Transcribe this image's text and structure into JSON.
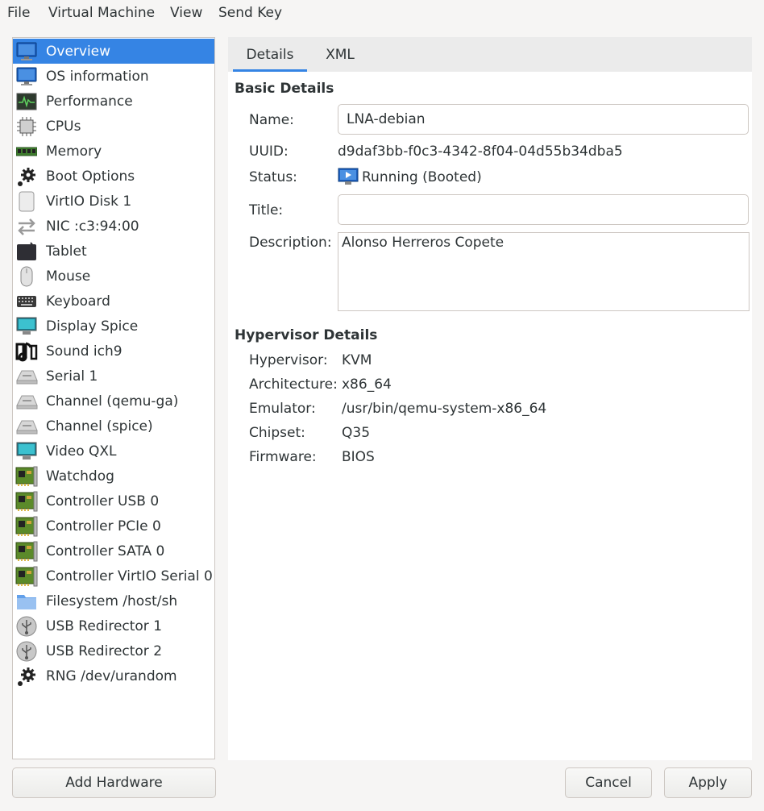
{
  "menu": {
    "file": "File",
    "vm": "Virtual Machine",
    "view": "View",
    "sendkey": "Send Key"
  },
  "sidebar": {
    "items": [
      {
        "label": "Overview",
        "icon": "monitor-icon"
      },
      {
        "label": "OS information",
        "icon": "monitor-icon"
      },
      {
        "label": "Performance",
        "icon": "performance-graph-icon"
      },
      {
        "label": "CPUs",
        "icon": "cpu-chip-icon"
      },
      {
        "label": "Memory",
        "icon": "memory-module-icon"
      },
      {
        "label": "Boot Options",
        "icon": "gear-icon"
      },
      {
        "label": "VirtIO Disk 1",
        "icon": "disk-icon"
      },
      {
        "label": "NIC :c3:94:00",
        "icon": "network-arrows-icon"
      },
      {
        "label": "Tablet",
        "icon": "tablet-icon"
      },
      {
        "label": "Mouse",
        "icon": "mouse-icon"
      },
      {
        "label": "Keyboard",
        "icon": "keyboard-icon"
      },
      {
        "label": "Display Spice",
        "icon": "display-icon"
      },
      {
        "label": "Sound ich9",
        "icon": "sound-icon"
      },
      {
        "label": "Serial 1",
        "icon": "serial-port-icon"
      },
      {
        "label": "Channel (qemu-ga)",
        "icon": "serial-port-icon"
      },
      {
        "label": "Channel (spice)",
        "icon": "serial-port-icon"
      },
      {
        "label": "Video QXL",
        "icon": "display-icon"
      },
      {
        "label": "Watchdog",
        "icon": "pci-card-icon"
      },
      {
        "label": "Controller USB 0",
        "icon": "pci-card-icon"
      },
      {
        "label": "Controller PCIe 0",
        "icon": "pci-card-icon"
      },
      {
        "label": "Controller SATA 0",
        "icon": "pci-card-icon"
      },
      {
        "label": "Controller VirtIO Serial 0",
        "icon": "pci-card-icon"
      },
      {
        "label": "Filesystem /host/sh",
        "icon": "folder-icon"
      },
      {
        "label": "USB Redirector 1",
        "icon": "usb-icon"
      },
      {
        "label": "USB Redirector 2",
        "icon": "usb-icon"
      },
      {
        "label": "RNG /dev/urandom",
        "icon": "gear-icon"
      }
    ],
    "selected_index": 0
  },
  "tabs": {
    "details": "Details",
    "xml": "XML",
    "active": "Details"
  },
  "basic": {
    "title": "Basic Details",
    "name_label": "Name:",
    "name_value": "LNA-debian",
    "uuid_label": "UUID:",
    "uuid_value": "d9daf3bb-f0c3-4342-8f04-04d55b34dba5",
    "status_label": "Status:",
    "status_value": "Running (Booted)",
    "title_label": "Title:",
    "title_value": "",
    "description_label": "Description:",
    "description_value": "Alonso Herreros Copete"
  },
  "hypervisor": {
    "title": "Hypervisor Details",
    "rows": [
      {
        "label": "Hypervisor:",
        "value": "KVM"
      },
      {
        "label": "Architecture:",
        "value": "x86_64"
      },
      {
        "label": "Emulator:",
        "value": "/usr/bin/qemu-system-x86_64"
      },
      {
        "label": "Chipset:",
        "value": "Q35"
      },
      {
        "label": "Firmware:",
        "value": "BIOS"
      }
    ]
  },
  "buttons": {
    "add_hardware": "Add Hardware",
    "cancel": "Cancel",
    "apply": "Apply"
  },
  "colors": {
    "accent": "#3584e4",
    "background": "#f6f5f4"
  }
}
